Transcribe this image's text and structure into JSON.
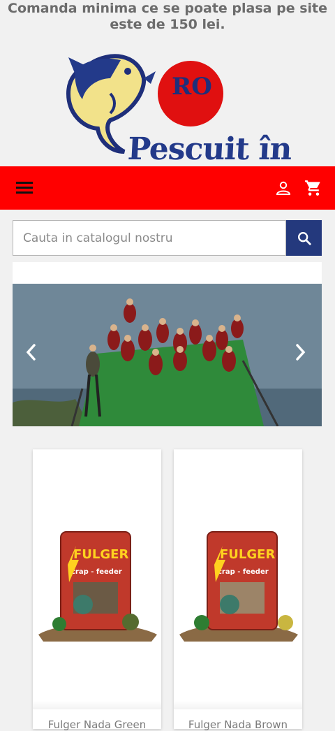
{
  "notice": {
    "line1": "Comanda minima ce se poate plasa pe site",
    "line2": "este de 150 lei."
  },
  "logo": {
    "text_top": "RO",
    "text_main": "Pescuit în"
  },
  "header": {
    "menu_icon": "hamburger-icon",
    "account_icon": "user-icon",
    "cart_icon": "shopping-cart-icon",
    "bar_color": "#ff0000"
  },
  "search": {
    "placeholder": "Cauta in catalogul nostru",
    "button_icon": "search-icon",
    "button_color": "#24397d"
  },
  "carousel": {
    "prev_icon": "chevron-left-icon",
    "next_icon": "chevron-right-icon"
  },
  "products": [
    {
      "name": "Fulger Nada Green",
      "brand": "FULGER",
      "subtitle": "crap - feeder"
    },
    {
      "name": "Fulger Nada Brown",
      "brand": "FULGER",
      "subtitle": "crap - feeder"
    }
  ]
}
